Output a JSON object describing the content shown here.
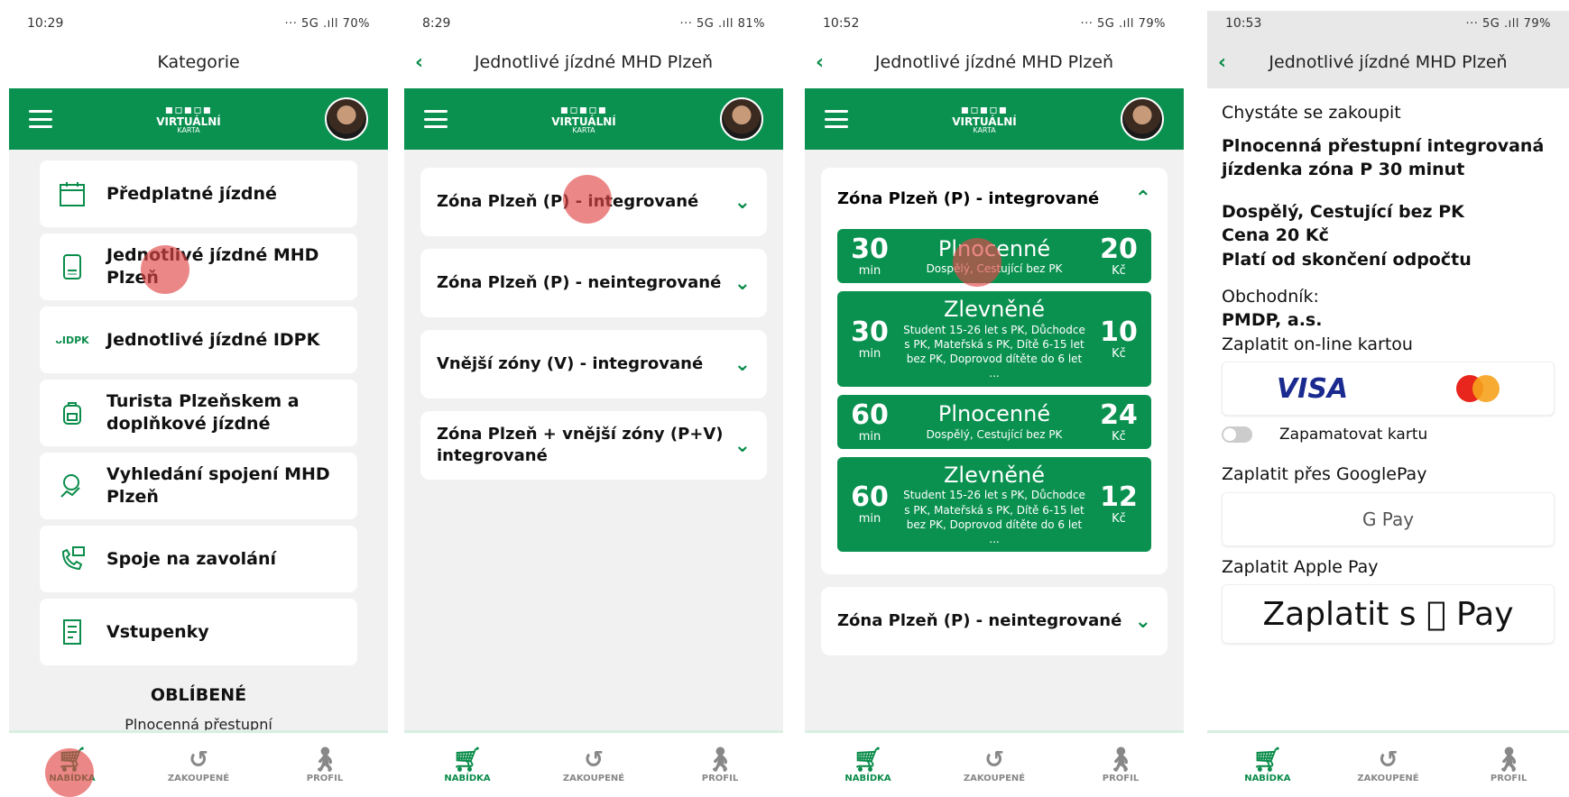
{
  "status": [
    {
      "time": "10:29",
      "right": "··· 5G .ıll 70%"
    },
    {
      "time": "8:29",
      "right": "··· 5G .ıll 81%"
    },
    {
      "time": "10:52",
      "right": "··· 5G .ıll 79%"
    },
    {
      "time": "10:53",
      "right": "··· 5G .ıll 79%"
    }
  ],
  "screen1": {
    "title": "Kategorie",
    "categories": [
      {
        "label": "Předplatné jízdné",
        "icon": "calendar-icon"
      },
      {
        "label": "Jednotlivé jízdné MHD Plzeň",
        "icon": "card-icon"
      },
      {
        "label": "Jednotlivé jízdné IDPK",
        "icon": "idpk-logo-icon"
      },
      {
        "label": "Turista Plzeňskem a doplňkové jízdné",
        "icon": "backpack-icon"
      },
      {
        "label": "Vyhledání spojení MHD Plzeň",
        "icon": "route-search-icon"
      },
      {
        "label": "Spoje na zavolání",
        "icon": "phone-call-icon"
      },
      {
        "label": "Vstupenky",
        "icon": "ticket-icon"
      }
    ],
    "favorites_title": "OBLÍBENÉ",
    "favorite_item": "Plnocenná přestupní"
  },
  "logo": {
    "text": "VIRTUÁLNÍ",
    "sub": "KARTA"
  },
  "screen2": {
    "title": "Jednotlivé jízdné MHD Plzeň",
    "zones": [
      "Zóna Plzeň (P) - integrované",
      "Zóna Plzeň (P) - neintegrované",
      "Vnější zóny (V) - integrované",
      "Zóna Plzeň + vnější zóny (P+V) integrované"
    ]
  },
  "screen3": {
    "title": "Jednotlivé jízdné MHD Plzeň",
    "open_zone": "Zóna Plzeň (P) - integrované",
    "tickets": [
      {
        "mins": "30",
        "unit": "min",
        "type": "Plnocenné",
        "desc": "Dospělý, Cestující bez PK",
        "price": "20",
        "currency": "Kč"
      },
      {
        "mins": "30",
        "unit": "min",
        "type": "Zlevněné",
        "desc": "Student 15-26 let s PK, Důchodce s PK, Mateřská s PK, Dítě 6-15 let bez PK, Doprovod dítěte do 6 let ...",
        "price": "10",
        "currency": "Kč"
      },
      {
        "mins": "60",
        "unit": "min",
        "type": "Plnocenné",
        "desc": "Dospělý, Cestující bez PK",
        "price": "24",
        "currency": "Kč"
      },
      {
        "mins": "60",
        "unit": "min",
        "type": "Zlevněné",
        "desc": "Student 15-26 let s PK, Důchodce s PK, Mateřská s PK, Dítě 6-15 let bez PK, Doprovod dítěte do 6 let ...",
        "price": "12",
        "currency": "Kč"
      }
    ],
    "next_zone": "Zóna Plzeň (P) - neintegrované"
  },
  "screen4": {
    "title": "Jednotlivé jízdné MHD Plzeň",
    "intro": "Chystáte se zakoupit",
    "product": "Plnocenná přestupní integrovaná jízdenka zóna P 30 minut",
    "passenger": "Dospělý, Cestující bez PK",
    "price": "Cena 20 Kč",
    "validity": "Platí od skončení odpočtu",
    "merchant_label": "Obchodník:",
    "merchant": "PMDP, a.s.",
    "pay_card": "Zaplatit on-line kartou",
    "visa": "VISA",
    "remember": "Zapamatovat kartu",
    "pay_google": "Zaplatit přes GooglePay",
    "gpay": "G Pay",
    "pay_apple": "Zaplatit Apple Pay",
    "apple_button": "Zaplatit s  Pay"
  },
  "nav": [
    "NABÍDKA",
    "ZAKOUPENÉ",
    "PROFIL"
  ],
  "colors": {
    "brand_green": "#0a9150",
    "tap_indicator": "#e24646"
  }
}
